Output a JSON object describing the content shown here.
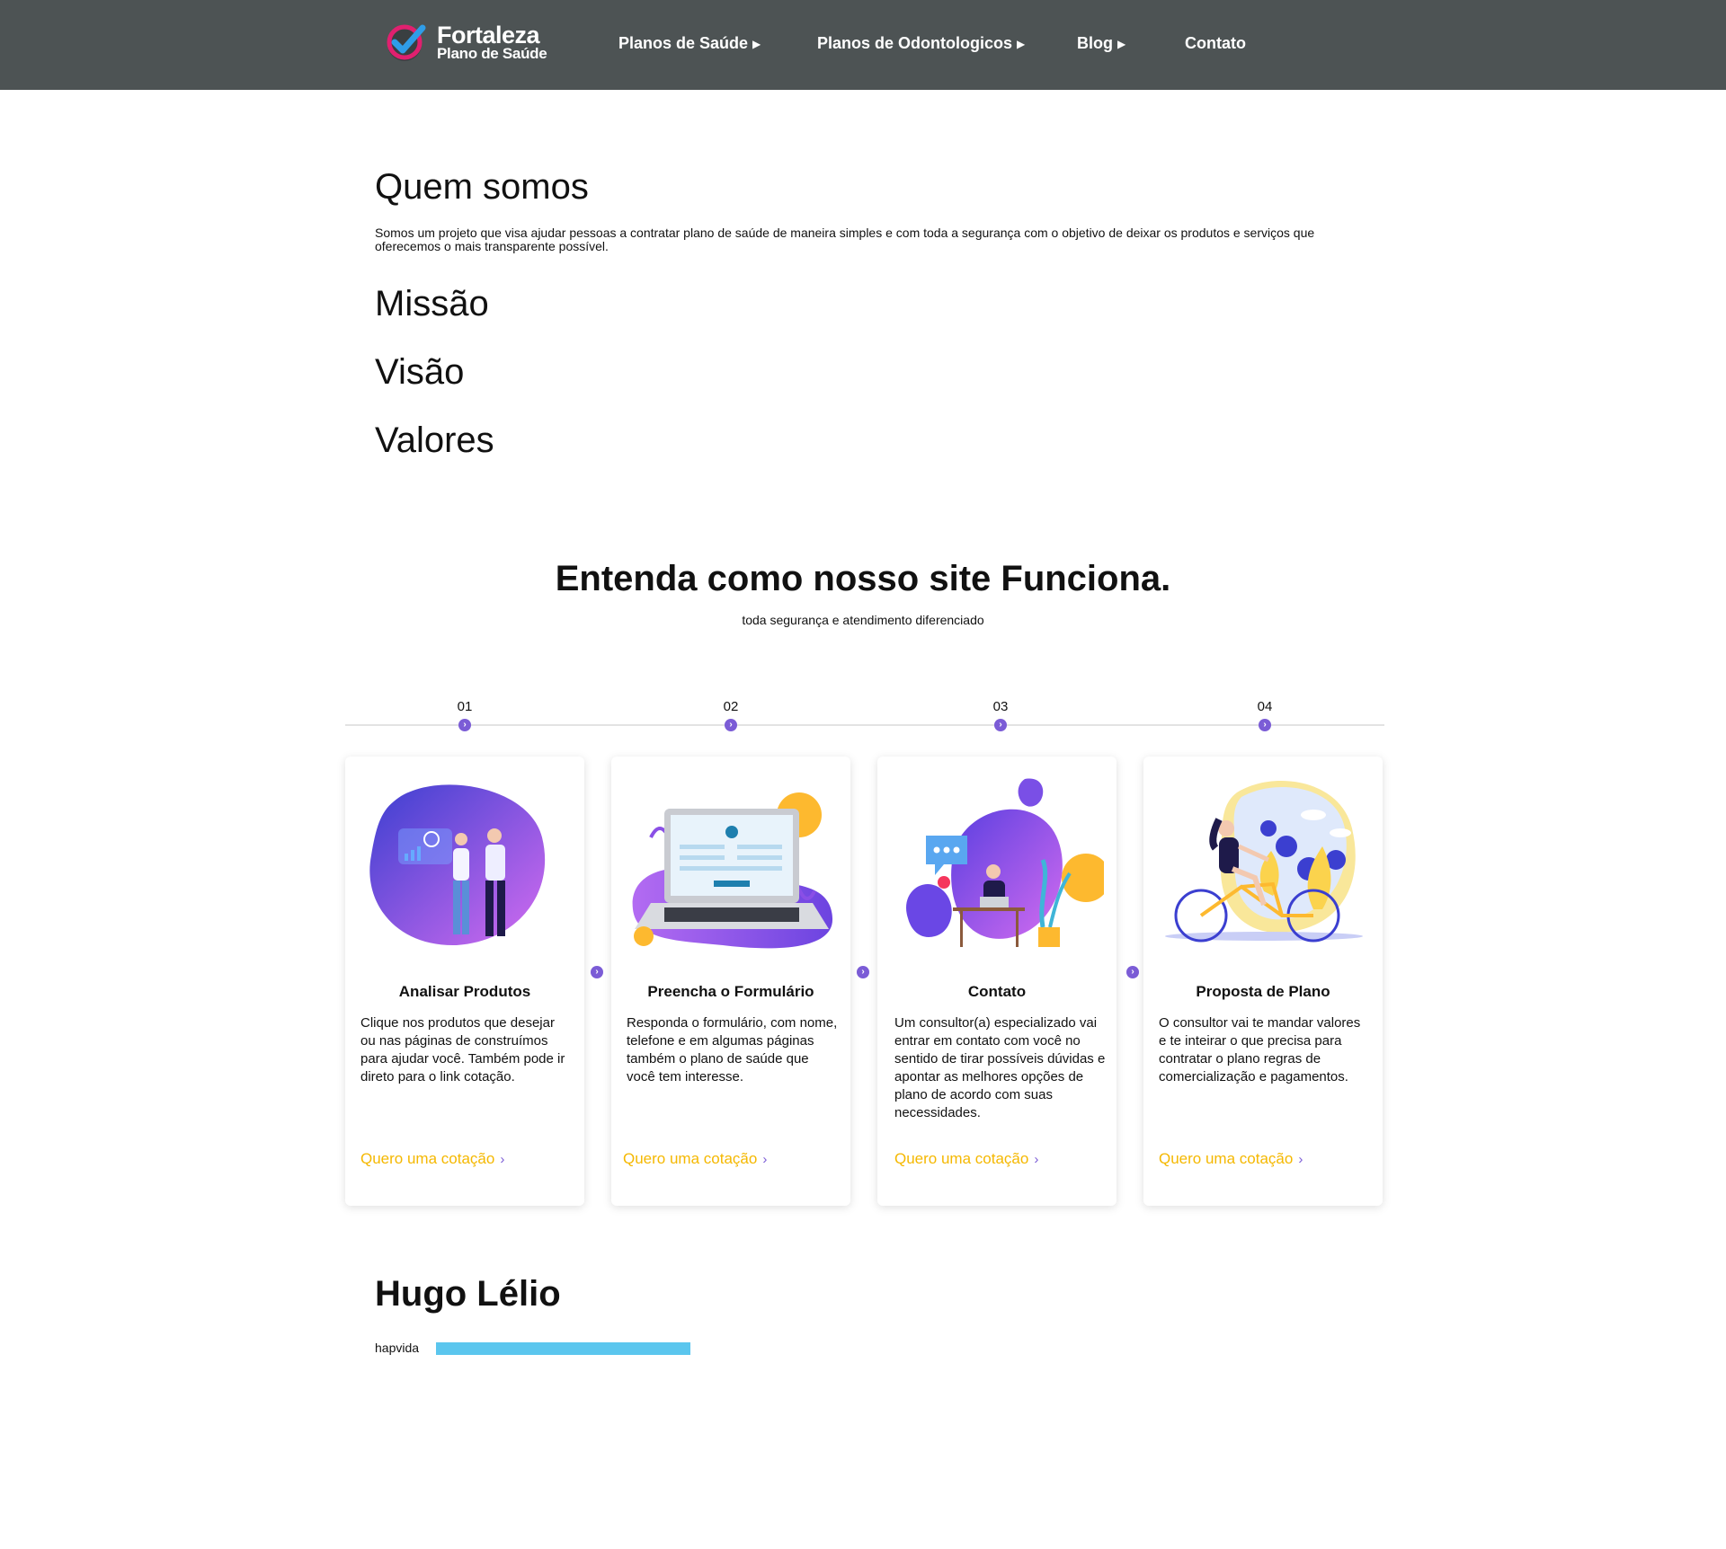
{
  "header": {
    "logo_title": "Fortaleza",
    "logo_subtitle": "Plano de Saúde",
    "nav": [
      {
        "label": "Planos de Saúde",
        "caret": "▶"
      },
      {
        "label": "Planos de Odontologicos",
        "caret": "▶"
      },
      {
        "label": "Blog",
        "caret": "▶"
      },
      {
        "label": "Contato"
      }
    ]
  },
  "about": {
    "heading": "Quem somos",
    "text": "Somos um projeto que visa ajudar pessoas a contratar plano de saúde de maneira simples e com toda a segurança com o objetivo de deixar os produtos e serviços que oferecemos o mais transparente possível.",
    "mission": "Missão",
    "vision": "Visão",
    "values": "Valores"
  },
  "how": {
    "title": "Entenda como nosso site Funciona.",
    "subtitle": "toda segurança e atendimento diferenciado",
    "steps": [
      {
        "num": "01",
        "title": "Analisar Produtos",
        "text": "Clique nos produtos que desejar ou nas páginas de construímos para ajudar você. Também pode ir direto para o link cotação.",
        "link": "Quero uma cotação",
        "icon": "vr-people-illustration"
      },
      {
        "num": "02",
        "title": "Preencha o Formulário",
        "text": "Responda o formulário, com nome, telefone e em algumas páginas também o plano de saúde que você tem interesse.",
        "link": "Quero uma cotação",
        "icon": "laptop-form-illustration"
      },
      {
        "num": "03",
        "title": "Contato",
        "text": "Um consultor(a) especializado vai entrar em contato com você no sentido de tirar possíveis dúvidas e apontar as melhores opções de plano de acordo com suas necessidades.",
        "link": "Quero uma cotação",
        "icon": "consultant-desk-illustration"
      },
      {
        "num": "04",
        "title": "Proposta de Plano",
        "text": "O consultor vai te mandar valores e te inteirar o que precisa para contratar o plano regras de comercialização e pagamentos.",
        "link": "Quero uma cotação",
        "icon": "bicycle-woman-illustration"
      }
    ]
  },
  "person": {
    "name": "Hugo Lélio",
    "bar_label": "hapvida",
    "bar_fill_fraction": 1.0
  },
  "colors": {
    "header_bg": "#4d5354",
    "accent_purple": "#7b5cd6",
    "link_yellow": "#f5b800",
    "bar_blue": "#5bc6ee"
  }
}
